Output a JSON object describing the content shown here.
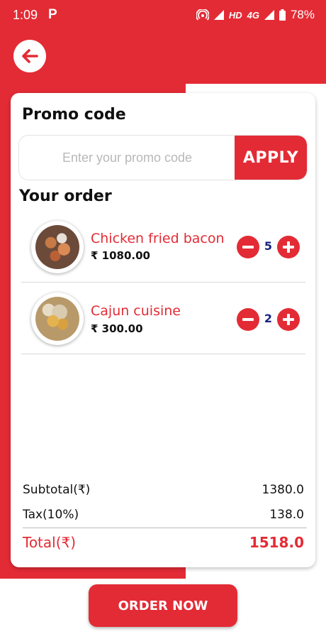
{
  "status_bar": {
    "time": "1:09",
    "app_icon": "P",
    "network_hd": "HD",
    "network_type": "4G",
    "battery": "78%"
  },
  "promo": {
    "title": "Promo code",
    "input_placeholder": "Enter your promo code",
    "input_value": "",
    "apply_label": "APPLY"
  },
  "order": {
    "title": "Your order",
    "items": [
      {
        "name": "Chicken fried bacon",
        "price": "₹ 1080.00",
        "quantity": "5",
        "image": "chicken-fried-bacon-photo"
      },
      {
        "name": "Cajun cuisine",
        "price": "₹ 300.00",
        "quantity": "2",
        "image": "cajun-cuisine-photo"
      }
    ]
  },
  "summary": {
    "subtotal_label": "Subtotal(₹)",
    "subtotal_value": "1380.0",
    "tax_label": "Tax(10%)",
    "tax_value": "138.0",
    "total_label": "Total(₹)",
    "total_value": "1518.0"
  },
  "order_now_label": "ORDER NOW",
  "icons": {
    "back": "arrow-left-icon",
    "minus": "minus-circle-icon",
    "plus": "plus-circle-icon"
  },
  "colors": {
    "primary": "#e32b35",
    "quantity_text": "#1a237e"
  }
}
